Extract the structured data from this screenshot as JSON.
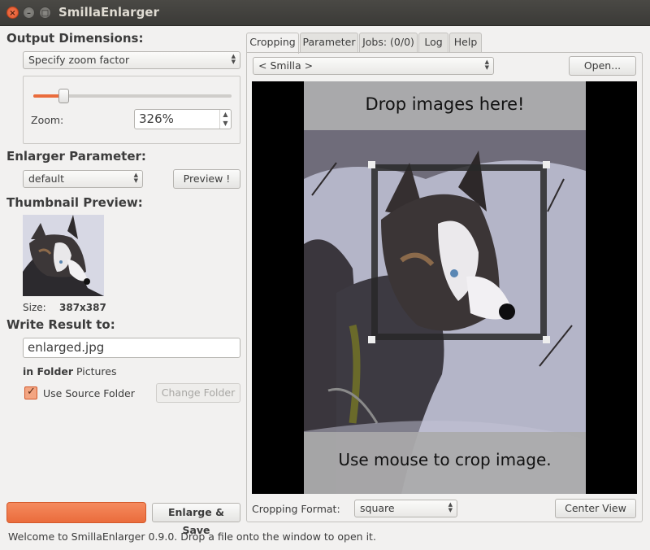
{
  "window": {
    "title": "SmillaEnlarger",
    "close_glyph": "×",
    "min_glyph": "–",
    "max_glyph": "□"
  },
  "left": {
    "output_dimensions_title": "Output Dimensions:",
    "dimension_mode": "Specify zoom factor",
    "zoom_label": "Zoom:",
    "zoom_value": "326%",
    "zoom_slider_fraction": 0.15,
    "enlarger_parameter_title": "Enlarger Parameter:",
    "parameter_preset": "default",
    "preview_button": "Preview !",
    "thumbnail_title": "Thumbnail Preview:",
    "size_label": "Size:",
    "size_value": "387x387",
    "write_result_title": "Write Result to:",
    "output_filename": "enlarged.jpg",
    "in_folder_label": "in Folder",
    "folder_value": "Pictures",
    "use_source_folder_label": "Use Source Folder",
    "use_source_folder_checked": true,
    "change_folder_button": "Change Folder",
    "enlarge_save_button": "Enlarge & Save",
    "progress_fraction": 1.0
  },
  "tabs": [
    {
      "label": "Cropping",
      "active": true
    },
    {
      "label": "Parameter",
      "active": false
    },
    {
      "label": "Jobs: (0/0)",
      "active": false
    },
    {
      "label": "Log",
      "active": false
    },
    {
      "label": "Help",
      "active": false
    }
  ],
  "cropping": {
    "source_select": "< Smilla >",
    "open_button": "Open...",
    "drop_hint": "Drop images here!",
    "mouse_hint": "Use mouse to crop image.",
    "format_label": "Cropping Format:",
    "format_value": "square",
    "center_view_button": "Center View"
  },
  "status": "Welcome to SmillaEnlarger 0.9.0.  Drop a file onto the window to open it.",
  "colors": {
    "accent_orange": "#ea6c3c",
    "titlebar": "#3b3a37",
    "preview_background": "#000000",
    "preview_banner": "#9a9a9a"
  },
  "icons": {
    "close": "close-icon",
    "minimize": "minimize-icon",
    "maximize": "maximize-icon",
    "checkbox": "checkmark-icon",
    "combo_arrows": "chevron-updown-icon"
  }
}
